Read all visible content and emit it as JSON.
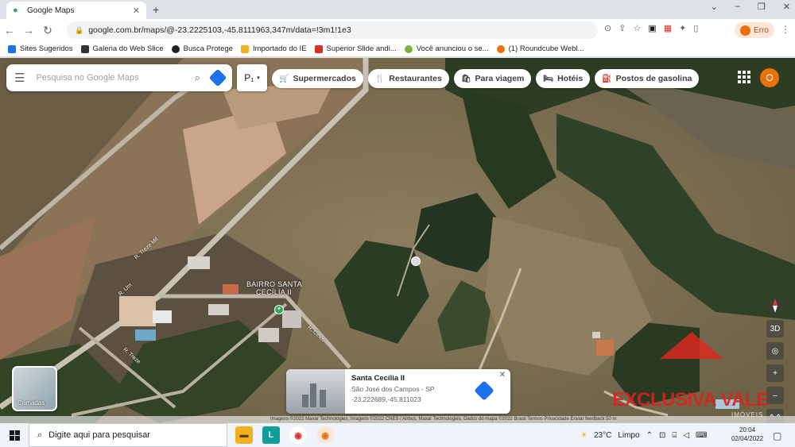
{
  "browser": {
    "tab_title": "Google Maps",
    "new_tab": "+",
    "window_controls": [
      "⌄",
      "–",
      "❐",
      "✕"
    ],
    "url": "google.com.br/maps/@-23.2225103,-45.8111963,347m/data=!3m1!1e3",
    "profile_label": "Erro",
    "bookmarks": [
      {
        "label": "Sites Sugeridos",
        "color": "#1a73e8"
      },
      {
        "label": "Galeria do Web Slice",
        "color": "#333333"
      },
      {
        "label": "Busca Protege",
        "color": "#222222"
      },
      {
        "label": "Importado do IE",
        "color": "#f2b01e"
      },
      {
        "label": "Superior Slide andi...",
        "color": "#d93025"
      },
      {
        "label": "Você anunciou o se...",
        "color": "#7cb342"
      },
      {
        "label": "(1) Roundcube Webl...",
        "color": "#e8710a"
      }
    ]
  },
  "maps": {
    "search_placeholder": "Pesquisa no Google Maps",
    "p_button": "P₁",
    "chips": [
      {
        "label": "Supermercados",
        "icon": "🛒"
      },
      {
        "label": "Restaurantes",
        "icon": "🍴"
      },
      {
        "label": "Para viagem",
        "icon": "🛍"
      },
      {
        "label": "Hotéis",
        "icon": "🛏"
      },
      {
        "label": "Postos de gasolina",
        "icon": "⛽"
      }
    ],
    "account_initial": "O",
    "place_label_line1": "BAIRRO SANTA",
    "place_label_line2": "CECÍLIA II",
    "road_labels": [
      "R. Treze Mil",
      "R. Um",
      "R. Treze",
      "R. Cinco"
    ],
    "layers_label": "Camadas",
    "controls": {
      "three_d": "3D",
      "zoom_in": "+",
      "zoom_out": "–",
      "expand": "⌃⌃"
    },
    "info_card": {
      "name": "Santa Cecília II",
      "city": "São José dos Campos - SP",
      "coords": "-23.222689,-45.811023",
      "close": "✕"
    },
    "attribution": "Imagens ©2022 Maxar Technologies, Imagens ©2022 CNES / Airbus, Maxar Technologies, Dados do mapa ©2022   Brasil   Termos   Privacidade   Enviar feedback   50 m",
    "watermark": "EXCLUSIVA VALE",
    "watermark_sub": "IMÓVEIS"
  },
  "taskbar": {
    "search_placeholder": "Digite aqui para pesquisar",
    "weather": "23°C",
    "weather_desc": "Limpo",
    "time": "20:04",
    "date": "02/04/2022"
  }
}
